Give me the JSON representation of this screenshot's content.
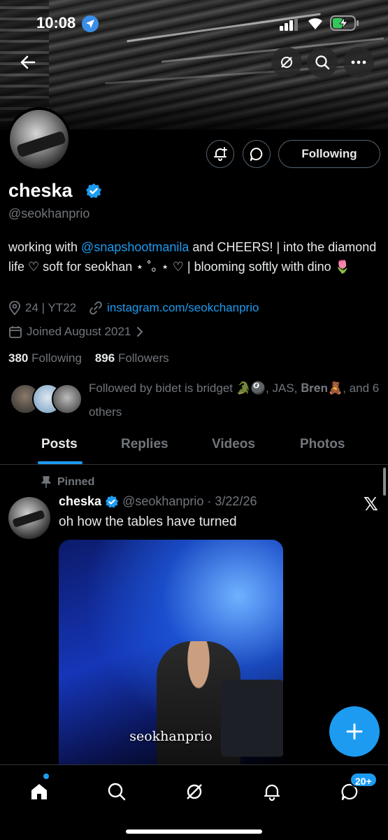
{
  "status_bar": {
    "time": "10:08"
  },
  "profile": {
    "name": "cheska",
    "handle": "@seokhanprio",
    "follow_button": "Following",
    "bio": {
      "part1": "working with ",
      "mention": "@snapshootmanila",
      "part2": " and CHEERS! | into the diamond life ♡ soft for seokhan ⋆ ˚｡ ⋆ ♡ | blooming softly with dino 🌷"
    },
    "location": "24 | YT22",
    "website": "instagram.com/seokchanprio",
    "joined": "Joined August 2021",
    "following_count": "380",
    "following_label": "Following",
    "followers_count": "896",
    "followers_label": "Followers",
    "followed_by": "Followed by bidet is bridget 🐊🎱, JAS, 𝐁𝐫𝐞𝐧🧸, and 6 others"
  },
  "tabs": [
    {
      "label": "Posts",
      "active": true
    },
    {
      "label": "Replies",
      "active": false
    },
    {
      "label": "Videos",
      "active": false
    },
    {
      "label": "Photos",
      "active": false
    }
  ],
  "post": {
    "pinned_label": "Pinned",
    "author_name": "cheska",
    "author_handle": "@seokhanprio",
    "separator": "·",
    "date": "3/22/26",
    "text": "oh how the tables have turned",
    "media_caption": "seokhanprio"
  },
  "nav": {
    "messages_badge": "20+"
  },
  "colors": {
    "accent": "#1d9bf0",
    "muted": "#71767b",
    "border": "#536471"
  }
}
